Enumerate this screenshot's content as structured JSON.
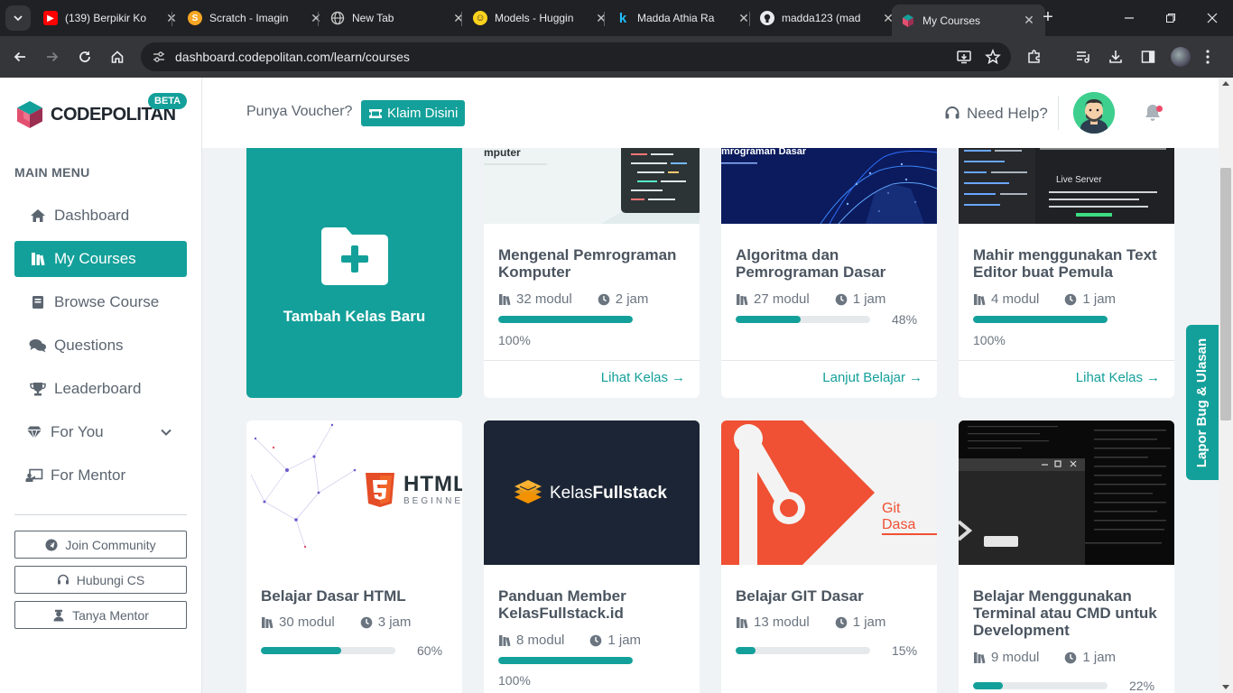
{
  "browser": {
    "tabs": [
      {
        "title": "(139) Berpikir Ko",
        "icon": "youtube-icon"
      },
      {
        "title": "Scratch - Imagin",
        "icon": "scratch-icon"
      },
      {
        "title": "New Tab",
        "icon": "globe-icon"
      },
      {
        "title": "Models - Huggin",
        "icon": "huggingface-icon"
      },
      {
        "title": "Madda Athia Ra",
        "icon": "kaggle-icon"
      },
      {
        "title": "madda123 (mad",
        "icon": "github-icon"
      },
      {
        "title": "My Courses",
        "icon": "codepolitan-icon",
        "active": true
      }
    ],
    "url": "dashboard.codepolitan.com/learn/courses"
  },
  "brand": {
    "name": "CODEPOLITAN",
    "badge": "BETA",
    "accent": "#14a09a"
  },
  "sidebar": {
    "menu_title": "MAIN MENU",
    "items": [
      {
        "label": "Dashboard",
        "icon": "home-icon"
      },
      {
        "label": "My Courses",
        "icon": "courses-icon",
        "active": true
      },
      {
        "label": "Browse Course",
        "icon": "book-icon"
      },
      {
        "label": "Questions",
        "icon": "comments-icon"
      },
      {
        "label": "Leaderboard",
        "icon": "trophy-icon"
      },
      {
        "label": "For You",
        "icon": "gem-icon",
        "expandable": true
      },
      {
        "label": "For Mentor",
        "icon": "chalkboard-icon"
      }
    ],
    "buttons": [
      {
        "label": "Join Community",
        "icon": "telegram-icon"
      },
      {
        "label": "Hubungi CS",
        "icon": "headset-icon"
      },
      {
        "label": "Tanya Mentor",
        "icon": "mentor-icon"
      }
    ]
  },
  "topbar": {
    "voucher_text": "Punya Voucher?",
    "claim_label": "Klaim Disini",
    "help_label": "Need Help?"
  },
  "add_card": {
    "label": "Tambah Kelas Baru"
  },
  "courses": [
    {
      "title": "Mengenal Pemrograman Komputer",
      "modules": "32 modul",
      "duration": "2 jam",
      "progress": 100,
      "progress_label": "100%",
      "cta": "Lihat Kelas",
      "thumb_text": "mputer"
    },
    {
      "title": "Algoritma dan Pemrograman Dasar",
      "modules": "27 modul",
      "duration": "1 jam",
      "progress": 48,
      "progress_label": "48%",
      "cta": "Lanjut Belajar",
      "thumb_text": "mrograman Dasar"
    },
    {
      "title": "Mahir menggunakan Text Editor buat Pemula",
      "modules": "4 modul",
      "duration": "1 jam",
      "progress": 100,
      "progress_label": "100%",
      "cta": "Lihat Kelas",
      "thumb_text": "Live Server"
    },
    {
      "title": "Belajar Dasar HTML",
      "modules": "30 modul",
      "duration": "3 jam",
      "progress": 60,
      "progress_label": "60%",
      "thumb_text": "HTML",
      "thumb_sub": "BEGINNER"
    },
    {
      "title": "Panduan Member KelasFullstack.id",
      "modules": "8 modul",
      "duration": "1 jam",
      "progress": 100,
      "progress_label": "100%",
      "thumb_text": "Kelas",
      "thumb_text_bold": "Fullstack"
    },
    {
      "title": "Belajar GIT Dasar",
      "modules": "13 modul",
      "duration": "1 jam",
      "progress": 15,
      "progress_label": "15%",
      "thumb_text": "Git Dasa"
    },
    {
      "title": "Belajar Menggunakan Terminal atau CMD untuk Development",
      "modules": "9 modul",
      "duration": "1 jam",
      "progress": 22,
      "progress_label": "22%"
    }
  ],
  "feedback_tab": "Lapor Bug & Ulasan"
}
